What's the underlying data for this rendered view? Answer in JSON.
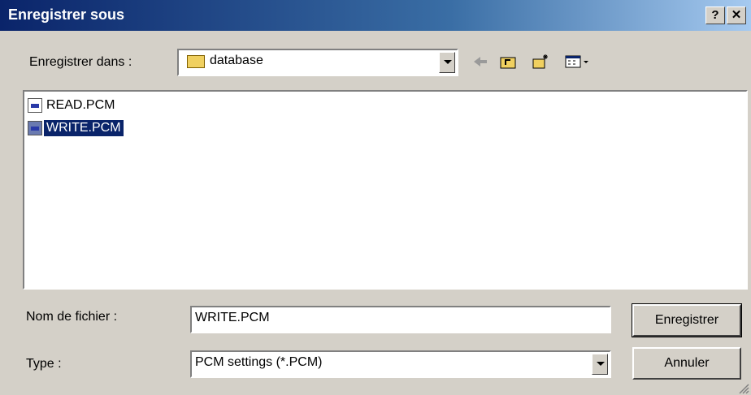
{
  "window": {
    "title": "Enregistrer sous",
    "help_label": "?",
    "close_label": "✕"
  },
  "save_in": {
    "label": "Enregistrer dans :",
    "value": "database"
  },
  "files": [
    {
      "name": "READ.PCM",
      "selected": false
    },
    {
      "name": "WRITE.PCM",
      "selected": true
    }
  ],
  "filename": {
    "label": "Nom de fichier :",
    "value": "WRITE.PCM"
  },
  "filetype": {
    "label": "Type :",
    "value": "PCM settings (*.PCM)"
  },
  "buttons": {
    "save": "Enregistrer",
    "cancel": "Annuler"
  }
}
